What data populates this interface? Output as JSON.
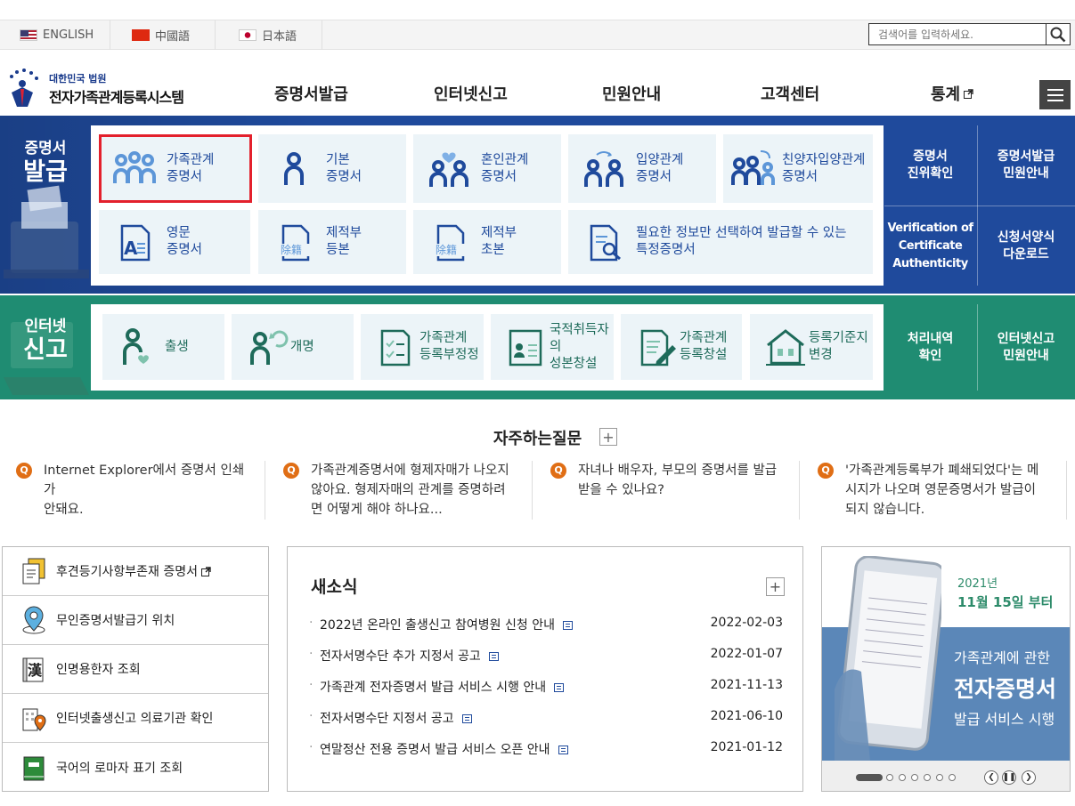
{
  "languages": [
    {
      "label": "ENGLISH"
    },
    {
      "label": "中國語"
    },
    {
      "label": "日本語"
    }
  ],
  "search": {
    "placeholder": "검색어를 입력하세요."
  },
  "logo": {
    "sub": "대한민국 법원",
    "main": "전자가족관계등록시스템"
  },
  "nav": [
    "증명서발급",
    "인터넷신고",
    "민원안내",
    "고객센터",
    "통계"
  ],
  "cert": {
    "title1": "증명서",
    "title2": "발급",
    "tiles": [
      [
        "가족관계",
        "증명서"
      ],
      [
        "기본",
        "증명서"
      ],
      [
        "혼인관계",
        "증명서"
      ],
      [
        "입양관계",
        "증명서"
      ],
      [
        "친양자입양관계",
        "증명서"
      ],
      [
        "영문",
        "증명서"
      ],
      [
        "제적부",
        "등본"
      ],
      [
        "제적부",
        "초본"
      ],
      [
        "필요한 정보만 선택하여 발급할 수 있는",
        "특정증명서"
      ]
    ],
    "side": [
      [
        "증명서",
        "진위확인"
      ],
      [
        "증명서발급",
        "민원안내"
      ],
      [
        "Verification of",
        "Certificate",
        "Authenticity"
      ],
      [
        "신청서양식",
        "다운로드"
      ]
    ]
  },
  "net": {
    "title1": "인터넷",
    "title2": "신고",
    "tiles": [
      [
        "출생"
      ],
      [
        "개명"
      ],
      [
        "가족관계",
        "등록부정정"
      ],
      [
        "국적취득자의",
        "성본창설"
      ],
      [
        "가족관계",
        "등록창설"
      ],
      [
        "등록기준지",
        "변경"
      ]
    ],
    "side": [
      [
        "처리내역",
        "확인"
      ],
      [
        "인터넷신고",
        "민원안내"
      ]
    ]
  },
  "faq": {
    "title": "자주하는질문",
    "items": [
      [
        "Internet Explorer에서 증명서 인쇄가",
        "안돼요."
      ],
      [
        "가족관계증명서에 형제자매가 나오지",
        "않아요. 형제자매의 관계를 증명하려",
        "면 어떻게 해야 하나요..."
      ],
      [
        "자녀나 배우자, 부모의 증명서를 발급",
        "받을 수 있나요?"
      ],
      [
        "'가족관계등록부가 폐쇄되었다'는 메",
        "시지가 나오며 영문증명서가 발급이",
        "되지 않습니다."
      ]
    ]
  },
  "quick": [
    "후견등기사항부존재 증명서",
    "무인증명서발급기 위치",
    "인명용한자 조회",
    "인터넷출생신고 의료기관 확인",
    "국어의 로마자 표기 조회"
  ],
  "news": {
    "title": "새소식",
    "items": [
      {
        "title": "2022년 온라인 출생신고 참여병원 신청 안내",
        "date": "2022-02-03"
      },
      {
        "title": "전자서명수단 추가 지정서 공고",
        "date": "2022-01-07"
      },
      {
        "title": "가족관계 전자증명서 발급 서비스 시행 안내",
        "date": "2021-11-13"
      },
      {
        "title": "전자서명수단 지정서 공고",
        "date": "2021-06-10"
      },
      {
        "title": "연말정산 전용 증명서 발급 서비스 오픈 안내",
        "date": "2021-01-12"
      }
    ]
  },
  "banner": {
    "year": "2021년",
    "date": "11월 15일 부터",
    "line1": "가족관계에 관한",
    "line2": "전자증명서",
    "line3": "발급 서비스 시행"
  },
  "colors": {
    "cert_band": "#1f4a9c",
    "net_band": "#1f8c72",
    "highlight": "#e3202c",
    "faq_q": "#e06e15"
  }
}
